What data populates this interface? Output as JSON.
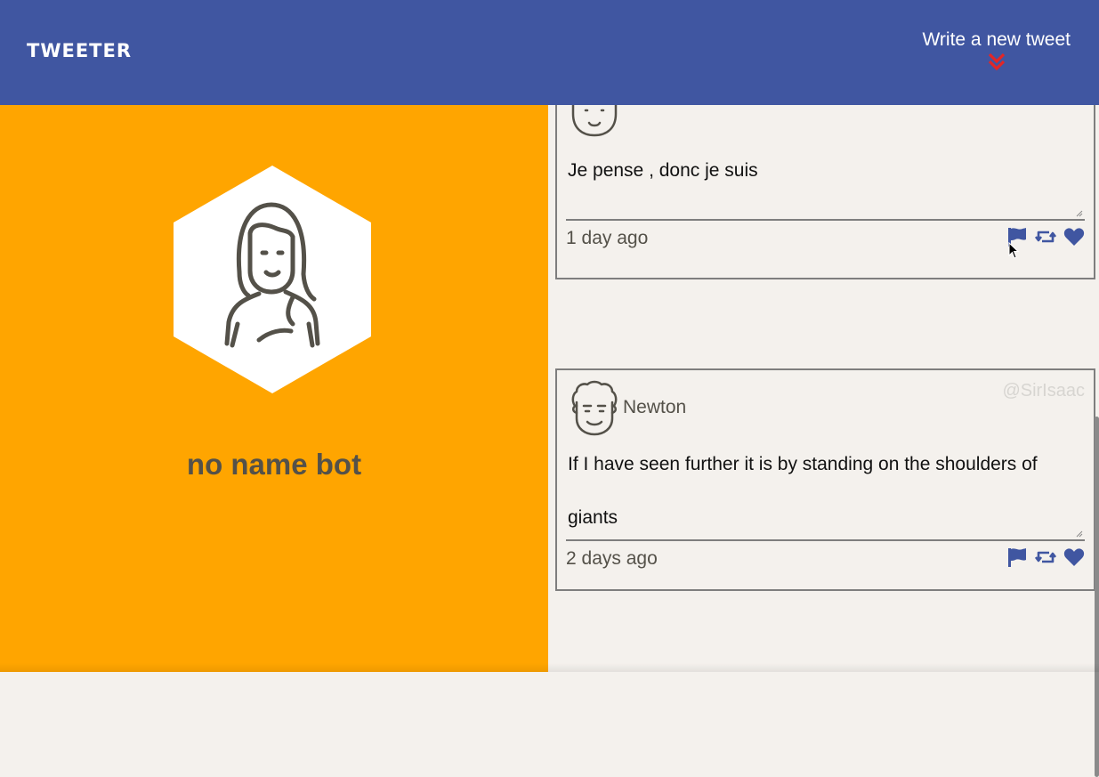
{
  "header": {
    "logo": "TWEETER",
    "compose_label": "Write a new tweet",
    "compose_icon": "double-chevron-down-icon"
  },
  "profile": {
    "name": "no name bot",
    "avatar_icon": "woman-avatar-icon"
  },
  "tweets": [
    {
      "author": "",
      "handle": "",
      "text": "Je pense , donc je suis",
      "time": "1 day ago",
      "avatar_icon": "bot-avatar-icon"
    },
    {
      "author": "Newton",
      "handle": "@SirIsaac",
      "text": "If I have seen further it is by standing on the shoulders of giants",
      "time": "2 days ago",
      "avatar_icon": "curly-hair-avatar-icon"
    }
  ],
  "actions": [
    "flag-icon",
    "retweet-icon",
    "heart-icon"
  ],
  "colors": {
    "header": "#4056a1",
    "profile_bg": "#ffa500",
    "feed_bg": "#f4f1ed",
    "accent_icon": "#4056a1",
    "chevron": "#e32626",
    "text_dark": "#545149"
  }
}
